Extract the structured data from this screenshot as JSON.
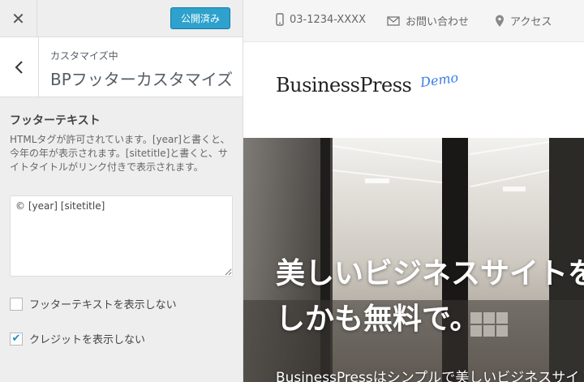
{
  "sidebar": {
    "publish_label": "公開済み",
    "customizing_label": "カスタマイズ中",
    "section_title": "BPフッターカスタマイズ",
    "control": {
      "title": "フッターテキスト",
      "description": "HTMLタグが許可されています。[year]と書くと、今年の年が表示されます。[sitetitle]と書くと、サイトタイトルがリンク付きで表示されます。",
      "textarea_value": "© [year] [sitetitle]"
    },
    "checkboxes": [
      {
        "label": "フッターテキストを表示しない",
        "checked": false
      },
      {
        "label": "クレジットを表示しない",
        "checked": true
      }
    ]
  },
  "preview": {
    "topbar": {
      "phone": "03-1234-XXXX",
      "contact": "お問い合わせ",
      "access": "アクセス"
    },
    "logo": {
      "name": "BusinessPress",
      "tag": "Demo"
    },
    "hero": {
      "heading_line1": "美しいビジネスサイトを",
      "heading_line2": "しかも無料で。",
      "subtext": "BusinessPressはシンプルで美しいビジネスサイト"
    }
  },
  "colors": {
    "accent": "#2ea2cc",
    "logo_tag": "#3b7be8"
  }
}
